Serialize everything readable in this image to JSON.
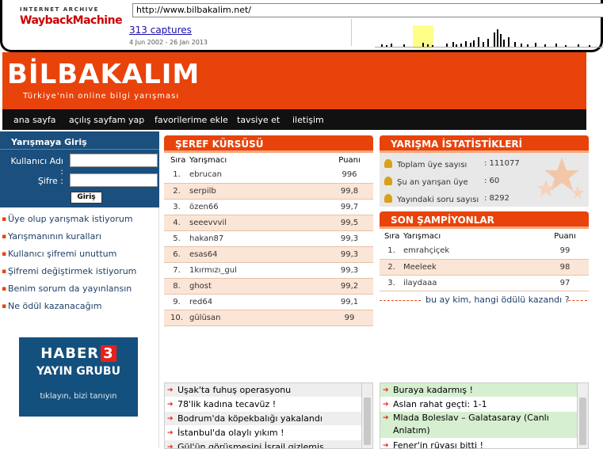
{
  "wayback": {
    "top_label": "INTERNET ARCHIVE",
    "logo": "WaybackMachine",
    "url": "http://www.bilbakalim.net/",
    "captures": "313 captures",
    "date_range": "4 Jun 2002 - 26 Jan 2013"
  },
  "header": {
    "logo": "BİLBAKALIM",
    "tagline": "Türkiye'nin online bilgi yarışması"
  },
  "nav": [
    "ana sayfa",
    "açılış sayfam yap",
    "favorilerime ekle",
    "tavsiye et",
    "iletişim"
  ],
  "login": {
    "title": "Yarışmaya Giriş",
    "user_label": "Kullanıcı Adı :",
    "pass_label": "Şifre :",
    "button": "Giriş"
  },
  "side_links": [
    "Üye olup yarışmak istiyorum",
    "Yarışmanının kuralları",
    "Kullanıcı şifremi unuttum",
    "Şifremi değiştirmek istiyorum",
    "Benim sorum da yayınlansın",
    "Ne ödül kazanacağım"
  ],
  "ad": {
    "line1": "HABER",
    "num": "3",
    "line2": "YAYIN GRUBU",
    "line3": "tıklayın, bizi tanıyın"
  },
  "seref": {
    "title": "ŞEREF KÜRSÜSÜ",
    "headers": [
      "Sıra",
      "Yarışmacı",
      "Puanı"
    ],
    "rows": [
      [
        "1.",
        "ebrucan",
        "996"
      ],
      [
        "2.",
        "serpilb",
        "99,8"
      ],
      [
        "3.",
        "özen66",
        "99,7"
      ],
      [
        "4.",
        "seeevvvil",
        "99,5"
      ],
      [
        "5.",
        "hakan87",
        "99,3"
      ],
      [
        "6.",
        "esas64",
        "99,3"
      ],
      [
        "7.",
        "1kırmızı_gul",
        "99,3"
      ],
      [
        "8.",
        "ghost",
        "99,2"
      ],
      [
        "9.",
        "red64",
        "99,1"
      ],
      [
        "10.",
        "gülüsan",
        "99"
      ]
    ]
  },
  "istatistik": {
    "title": "YARIŞMA İSTATİSTİKLERİ",
    "items": [
      {
        "label": "Toplam üye sayısı",
        "value": ": 111077"
      },
      {
        "label": "Şu an yarışan üye",
        "value": ": 60"
      },
      {
        "label": "Yayındaki soru sayısı",
        "value": ": 8292"
      }
    ]
  },
  "sampiyon": {
    "title": "SON ŞAMPİYONLAR",
    "headers": [
      "Sıra",
      "Yarışmacı",
      "Puanı"
    ],
    "rows": [
      [
        "1.",
        "emrahçiçek",
        "99"
      ],
      [
        "2.",
        "Meeleek",
        "98"
      ],
      [
        "3.",
        "ilaydaaa",
        "97"
      ]
    ],
    "footer": "bu ay kim, hangi ödülü kazandı ?"
  },
  "news_left": [
    "Uşak'ta fuhuş operasyonu",
    "78'lik kadına tecavüz !",
    "Bodrum'da köpekbalığı yakalandı",
    "İstanbul'da olaylı yıkım !",
    "Gül'ün görüşmesini İsrail gizlemiş"
  ],
  "news_right": [
    "Buraya kadarmış !",
    "Aslan rahat geçti: 1-1",
    "Mlada Boleslav – Galatasaray (Canlı Anlatım)",
    "Fener'in rüyası bitti !"
  ],
  "colors": {
    "accent": "#e8430b",
    "login_bg": "#1b4f7d",
    "nav_bg": "#111111"
  }
}
